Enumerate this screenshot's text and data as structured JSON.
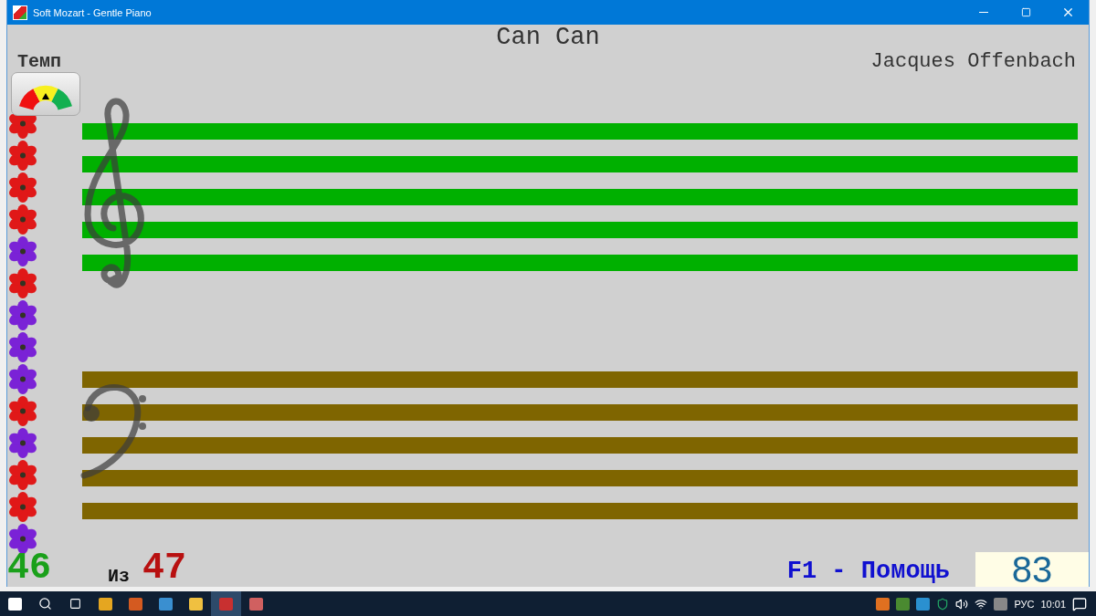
{
  "window": {
    "title": "Soft Mozart - Gentle Piano"
  },
  "song": {
    "title": "Can Can",
    "composer": "Jacques Offenbach"
  },
  "tempo": {
    "label": "Темп"
  },
  "flowers": [
    {
      "color": "#e01818"
    },
    {
      "color": "#e01818"
    },
    {
      "color": "#e01818"
    },
    {
      "color": "#e01818"
    },
    {
      "color": "#7a22d6"
    },
    {
      "color": "#e01818"
    },
    {
      "color": "#7a22d6"
    },
    {
      "color": "#7a22d6"
    },
    {
      "color": "#7a22d6"
    },
    {
      "color": "#e01818"
    },
    {
      "color": "#7a22d6"
    },
    {
      "color": "#e01818"
    },
    {
      "color": "#e01818"
    },
    {
      "color": "#7a22d6"
    }
  ],
  "staves": [
    {
      "kind": "treble",
      "color": "#00b000"
    },
    {
      "kind": "bass",
      "color": "#7f6500"
    }
  ],
  "score": {
    "current": "46",
    "separator": "Из",
    "total": "47"
  },
  "help": "F1 - Помощь",
  "counter": "83",
  "taskbar": {
    "language": "РУС",
    "time": "10:01"
  }
}
